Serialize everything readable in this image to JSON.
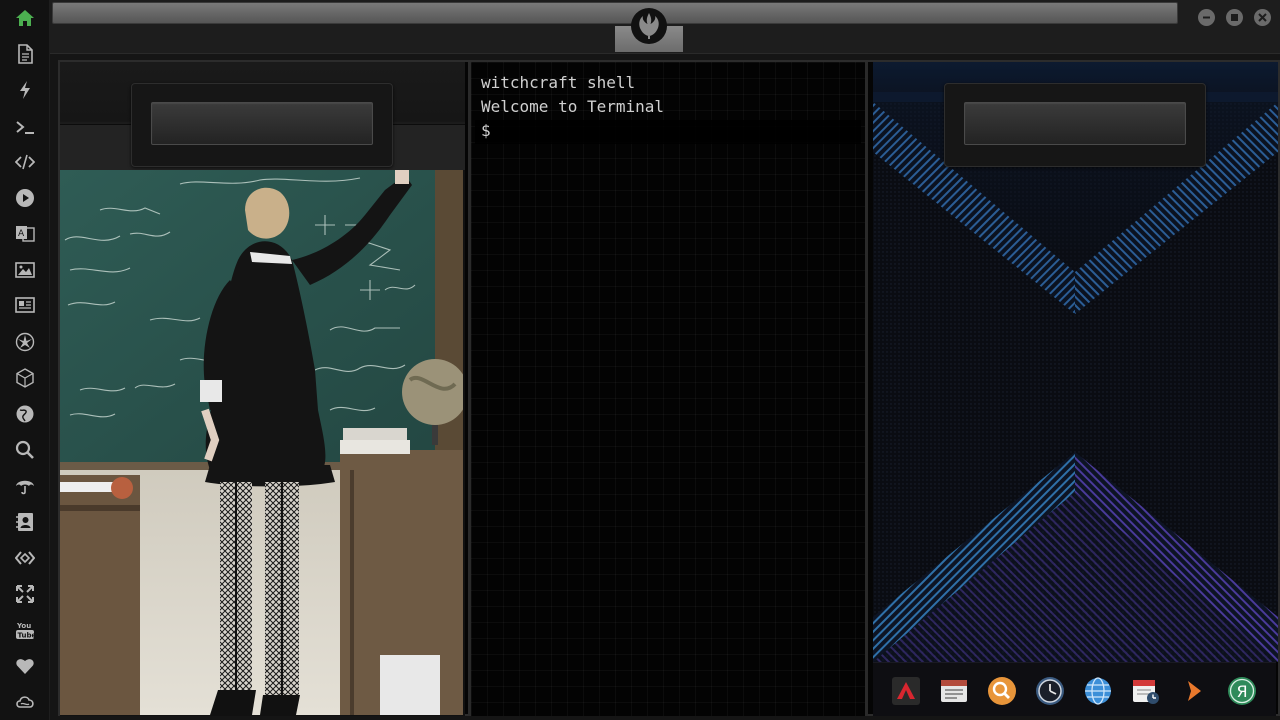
{
  "sidebar": {
    "items": [
      {
        "name": "home-icon"
      },
      {
        "name": "document-icon"
      },
      {
        "name": "lightning-icon"
      },
      {
        "name": "terminal-icon"
      },
      {
        "name": "code-icon"
      },
      {
        "name": "play-icon"
      },
      {
        "name": "translate-icon"
      },
      {
        "name": "image-icon"
      },
      {
        "name": "newspaper-icon"
      },
      {
        "name": "rebel-alliance-icon"
      },
      {
        "name": "cube-icon"
      },
      {
        "name": "globe-icon"
      },
      {
        "name": "search-icon"
      },
      {
        "name": "umbrella-icon"
      },
      {
        "name": "contacts-icon"
      },
      {
        "name": "diamond-code-icon"
      },
      {
        "name": "expand-icon"
      },
      {
        "name": "youtube-icon"
      },
      {
        "name": "heart-icon"
      },
      {
        "name": "cloud-icon"
      }
    ],
    "active_color": "#4caf50",
    "icon_color": "#b8b8b8"
  },
  "titlebar": {
    "logo": "rebel-alliance-logo",
    "window_buttons": [
      "minimize-icon",
      "maximize-icon",
      "close-icon"
    ]
  },
  "terminal": {
    "title": "witchcraft shell",
    "welcome": "Welcome to Terminal",
    "prompt": "$"
  },
  "dock": {
    "items": [
      {
        "name": "app-launcher-icon"
      },
      {
        "name": "calendar-news-icon"
      },
      {
        "name": "search-app-icon"
      },
      {
        "name": "clock-icon"
      },
      {
        "name": "browser-globe-icon"
      },
      {
        "name": "calendar-clock-icon"
      },
      {
        "name": "arrow-app-icon"
      },
      {
        "name": "yandex-icon"
      }
    ]
  }
}
